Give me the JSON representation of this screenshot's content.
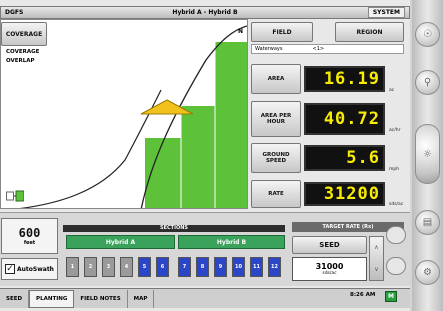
{
  "window": {
    "left_label": "DGFS",
    "title": "Hybrid A - Hybrid B",
    "right_button": "SYSTEM"
  },
  "map": {
    "coverage_button": "COVERAGE",
    "legend": [
      "COVERAGE",
      "OVERLAP"
    ],
    "north_label": "N",
    "colors": {
      "coverage": "#5dc23a",
      "marker": "#f1c21b"
    }
  },
  "panel": {
    "field_tab": "FIELD",
    "region_tab": "REGION",
    "subheader": [
      "Waterways",
      "<1>"
    ],
    "metrics": [
      {
        "label": "AREA",
        "value": "16.19",
        "unit": "ac"
      },
      {
        "label": "AREA PER HOUR",
        "value": "40.72",
        "unit": "ac/hr"
      },
      {
        "label": "GROUND SPEED",
        "value": "5.6",
        "unit": "mph"
      },
      {
        "label": "RATE",
        "value": "31200",
        "unit": "sds/ac"
      }
    ]
  },
  "bottom": {
    "width_value": "600",
    "width_unit": "feet",
    "autoswath_label": "AutoSwath",
    "sections_title": "SECTIONS",
    "hybrid_a": "Hybrid A",
    "hybrid_b": "Hybrid B",
    "sections": [
      {
        "n": "1",
        "state": "off"
      },
      {
        "n": "2",
        "state": "off"
      },
      {
        "n": "3",
        "state": "off"
      },
      {
        "n": "4",
        "state": "off"
      },
      {
        "n": "5",
        "state": "on"
      },
      {
        "n": "6",
        "state": "on"
      },
      {
        "n": "7",
        "state": "on"
      },
      {
        "n": "8",
        "state": "on"
      },
      {
        "n": "9",
        "state": "on"
      },
      {
        "n": "10",
        "state": "on"
      },
      {
        "n": "11",
        "state": "on"
      },
      {
        "n": "12",
        "state": "on"
      }
    ],
    "target_rate_title": "TARGET RATE (Rx)",
    "seed_button": "SEED",
    "seed_rate_value": "31000",
    "seed_rate_unit": "sds/ac"
  },
  "tabs": [
    "SEED",
    "PLANTING",
    "FIELD NOTES",
    "MAP"
  ],
  "active_tab": "PLANTING",
  "clock": "8:26 AM",
  "status_badge": "M"
}
